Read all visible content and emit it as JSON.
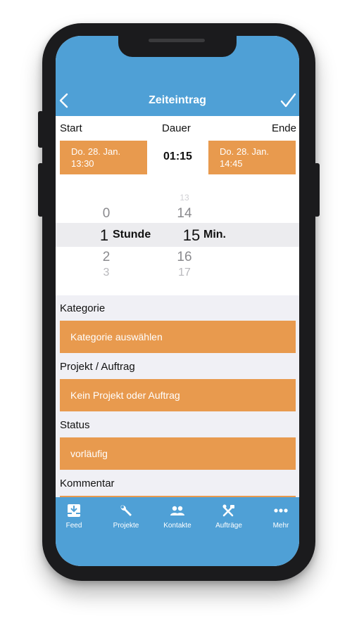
{
  "header": {
    "title": "Zeiteintrag",
    "background": "#4fa0d6"
  },
  "time": {
    "start_label": "Start",
    "dauer_label": "Dauer",
    "ende_label": "Ende",
    "start_line1": "Do. 28. Jan.",
    "start_line2": "13:30",
    "end_line1": "Do. 28. Jan.",
    "end_line2": "14:45",
    "duration": "01:15"
  },
  "picker": {
    "hours": {
      "above": [
        "0"
      ],
      "selected": "1",
      "below": [
        "2",
        "3"
      ],
      "unit": "Stunde"
    },
    "minutes": {
      "above": [
        "13",
        "14"
      ],
      "selected": "15",
      "below": [
        "16",
        "17"
      ],
      "unit": "Min."
    }
  },
  "form": {
    "kategorie_label": "Kategorie",
    "kategorie_value": "Kategorie auswählen",
    "projekt_label": "Projekt / Auftrag",
    "projekt_value": "Kein Projekt oder Auftrag",
    "status_label": "Status",
    "status_value": "vorläufig",
    "kommentar_label": "Kommentar"
  },
  "tabs": [
    {
      "label": "Feed",
      "icon": "inbox-icon"
    },
    {
      "label": "Projekte",
      "icon": "wrench-icon"
    },
    {
      "label": "Kontakte",
      "icon": "people-icon"
    },
    {
      "label": "Aufträge",
      "icon": "tools-icon"
    },
    {
      "label": "Mehr",
      "icon": "more-dots-icon"
    }
  ],
  "colors": {
    "accent_blue": "#4fa0d6",
    "accent_orange": "#e89a4e",
    "background": "#f0f0f5"
  }
}
